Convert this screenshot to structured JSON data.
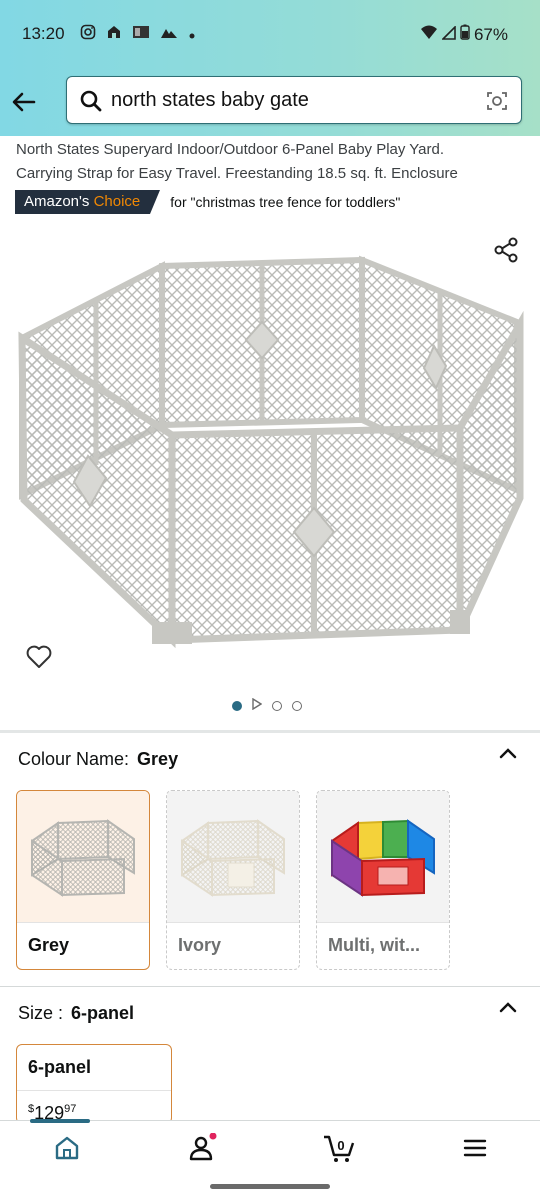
{
  "status": {
    "time": "13:20",
    "battery": "67%"
  },
  "search": {
    "query": "north states baby gate"
  },
  "product": {
    "title_line1": "North States Superyard Indoor/Outdoor 6-Panel Baby Play Yard.",
    "title_line2": "Carrying Strap for Easy Travel. Freestanding 18.5 sq. ft. Enclosure",
    "badge_prefix": "Amazon's",
    "badge_choice": "Choice",
    "badge_for": "for \"christmas tree fence for toddlers\""
  },
  "gallery": {
    "dot_count": 4,
    "active_index": 0
  },
  "colour": {
    "label": "Colour Name:",
    "selected": "Grey",
    "options": [
      {
        "label": "Grey"
      },
      {
        "label": "Ivory"
      },
      {
        "label": "Multi, wit..."
      }
    ]
  },
  "size": {
    "label": "Size :",
    "selected": "6-panel",
    "options": [
      {
        "label": "6-panel",
        "price_symbol": "$",
        "price_whole": "129",
        "price_fraction": "97"
      }
    ]
  },
  "bottom_nav": {
    "cart_count": "0"
  },
  "colors": {
    "accent": "#2a6b84",
    "badge_bg": "#232f3e",
    "choice": "#f08804",
    "selected_border": "#d4873b"
  }
}
